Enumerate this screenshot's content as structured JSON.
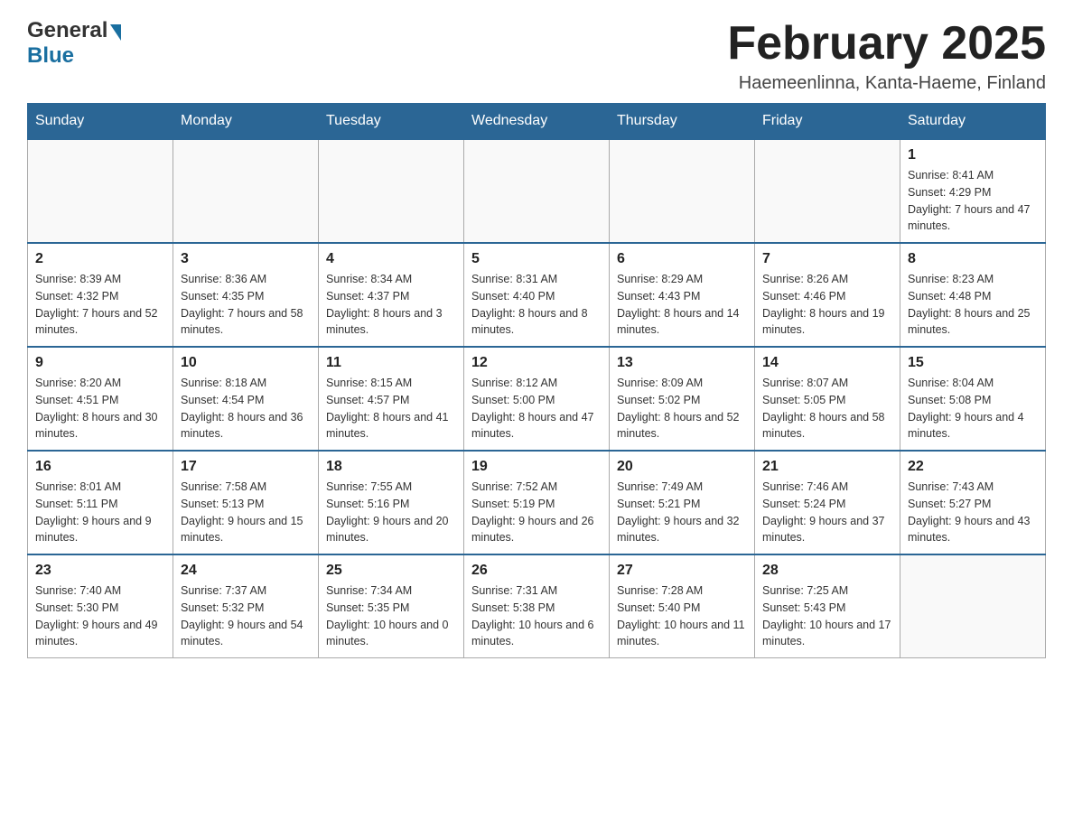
{
  "header": {
    "title": "February 2025",
    "subtitle": "Haemeenlinna, Kanta-Haeme, Finland",
    "logo_general": "General",
    "logo_blue": "Blue"
  },
  "days_of_week": [
    "Sunday",
    "Monday",
    "Tuesday",
    "Wednesday",
    "Thursday",
    "Friday",
    "Saturday"
  ],
  "weeks": [
    [
      {
        "day": "",
        "info": ""
      },
      {
        "day": "",
        "info": ""
      },
      {
        "day": "",
        "info": ""
      },
      {
        "day": "",
        "info": ""
      },
      {
        "day": "",
        "info": ""
      },
      {
        "day": "",
        "info": ""
      },
      {
        "day": "1",
        "info": "Sunrise: 8:41 AM\nSunset: 4:29 PM\nDaylight: 7 hours and 47 minutes."
      }
    ],
    [
      {
        "day": "2",
        "info": "Sunrise: 8:39 AM\nSunset: 4:32 PM\nDaylight: 7 hours and 52 minutes."
      },
      {
        "day": "3",
        "info": "Sunrise: 8:36 AM\nSunset: 4:35 PM\nDaylight: 7 hours and 58 minutes."
      },
      {
        "day": "4",
        "info": "Sunrise: 8:34 AM\nSunset: 4:37 PM\nDaylight: 8 hours and 3 minutes."
      },
      {
        "day": "5",
        "info": "Sunrise: 8:31 AM\nSunset: 4:40 PM\nDaylight: 8 hours and 8 minutes."
      },
      {
        "day": "6",
        "info": "Sunrise: 8:29 AM\nSunset: 4:43 PM\nDaylight: 8 hours and 14 minutes."
      },
      {
        "day": "7",
        "info": "Sunrise: 8:26 AM\nSunset: 4:46 PM\nDaylight: 8 hours and 19 minutes."
      },
      {
        "day": "8",
        "info": "Sunrise: 8:23 AM\nSunset: 4:48 PM\nDaylight: 8 hours and 25 minutes."
      }
    ],
    [
      {
        "day": "9",
        "info": "Sunrise: 8:20 AM\nSunset: 4:51 PM\nDaylight: 8 hours and 30 minutes."
      },
      {
        "day": "10",
        "info": "Sunrise: 8:18 AM\nSunset: 4:54 PM\nDaylight: 8 hours and 36 minutes."
      },
      {
        "day": "11",
        "info": "Sunrise: 8:15 AM\nSunset: 4:57 PM\nDaylight: 8 hours and 41 minutes."
      },
      {
        "day": "12",
        "info": "Sunrise: 8:12 AM\nSunset: 5:00 PM\nDaylight: 8 hours and 47 minutes."
      },
      {
        "day": "13",
        "info": "Sunrise: 8:09 AM\nSunset: 5:02 PM\nDaylight: 8 hours and 52 minutes."
      },
      {
        "day": "14",
        "info": "Sunrise: 8:07 AM\nSunset: 5:05 PM\nDaylight: 8 hours and 58 minutes."
      },
      {
        "day": "15",
        "info": "Sunrise: 8:04 AM\nSunset: 5:08 PM\nDaylight: 9 hours and 4 minutes."
      }
    ],
    [
      {
        "day": "16",
        "info": "Sunrise: 8:01 AM\nSunset: 5:11 PM\nDaylight: 9 hours and 9 minutes."
      },
      {
        "day": "17",
        "info": "Sunrise: 7:58 AM\nSunset: 5:13 PM\nDaylight: 9 hours and 15 minutes."
      },
      {
        "day": "18",
        "info": "Sunrise: 7:55 AM\nSunset: 5:16 PM\nDaylight: 9 hours and 20 minutes."
      },
      {
        "day": "19",
        "info": "Sunrise: 7:52 AM\nSunset: 5:19 PM\nDaylight: 9 hours and 26 minutes."
      },
      {
        "day": "20",
        "info": "Sunrise: 7:49 AM\nSunset: 5:21 PM\nDaylight: 9 hours and 32 minutes."
      },
      {
        "day": "21",
        "info": "Sunrise: 7:46 AM\nSunset: 5:24 PM\nDaylight: 9 hours and 37 minutes."
      },
      {
        "day": "22",
        "info": "Sunrise: 7:43 AM\nSunset: 5:27 PM\nDaylight: 9 hours and 43 minutes."
      }
    ],
    [
      {
        "day": "23",
        "info": "Sunrise: 7:40 AM\nSunset: 5:30 PM\nDaylight: 9 hours and 49 minutes."
      },
      {
        "day": "24",
        "info": "Sunrise: 7:37 AM\nSunset: 5:32 PM\nDaylight: 9 hours and 54 minutes."
      },
      {
        "day": "25",
        "info": "Sunrise: 7:34 AM\nSunset: 5:35 PM\nDaylight: 10 hours and 0 minutes."
      },
      {
        "day": "26",
        "info": "Sunrise: 7:31 AM\nSunset: 5:38 PM\nDaylight: 10 hours and 6 minutes."
      },
      {
        "day": "27",
        "info": "Sunrise: 7:28 AM\nSunset: 5:40 PM\nDaylight: 10 hours and 11 minutes."
      },
      {
        "day": "28",
        "info": "Sunrise: 7:25 AM\nSunset: 5:43 PM\nDaylight: 10 hours and 17 minutes."
      },
      {
        "day": "",
        "info": ""
      }
    ]
  ]
}
